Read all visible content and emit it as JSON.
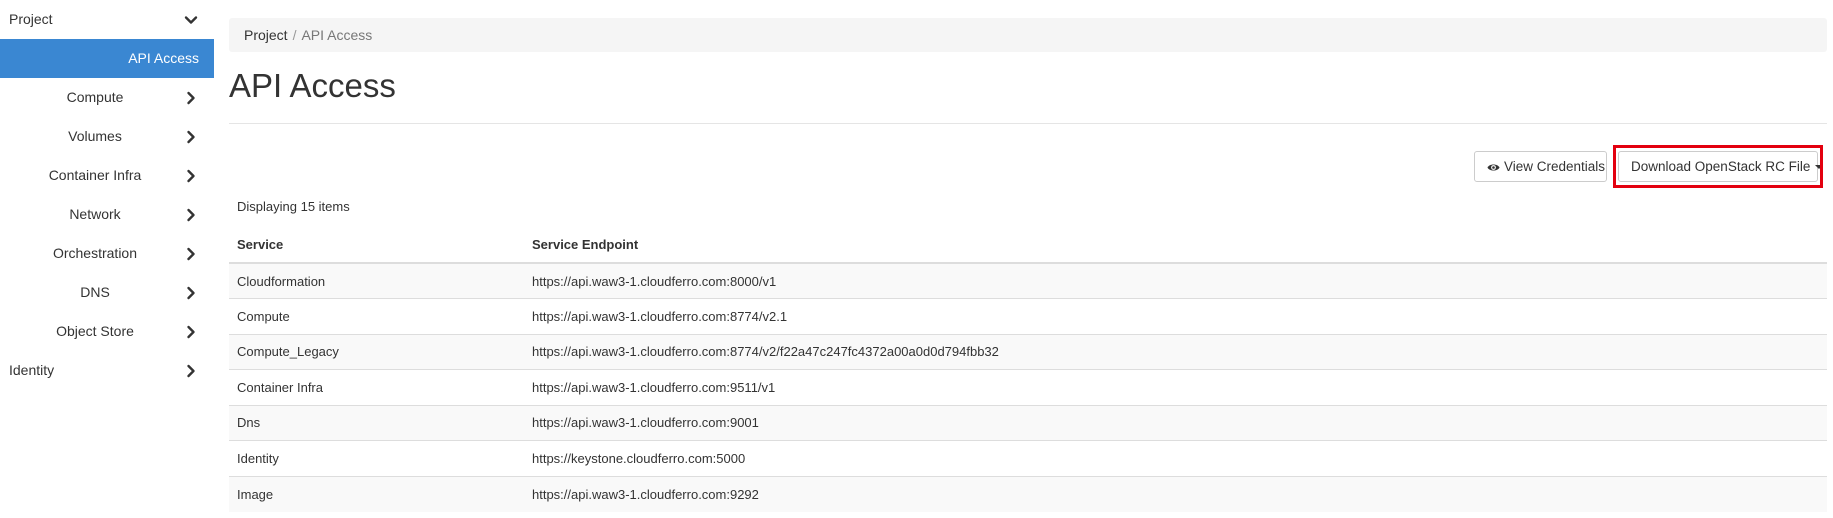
{
  "sidebar": {
    "project": "Project",
    "active_item": "API Access",
    "items": [
      {
        "label": "Compute"
      },
      {
        "label": "Volumes"
      },
      {
        "label": "Container Infra"
      },
      {
        "label": "Network"
      },
      {
        "label": "Orchestration"
      },
      {
        "label": "DNS"
      },
      {
        "label": "Object Store"
      }
    ],
    "identity": "Identity"
  },
  "breadcrumb": {
    "root": "Project",
    "separator": "/",
    "current": "API Access"
  },
  "page": {
    "title": "API Access"
  },
  "actions": {
    "view_credentials": "View Credentials",
    "download_rc": "Download OpenStack RC File"
  },
  "table": {
    "count_text": "Displaying 15 items",
    "headers": {
      "service": "Service",
      "endpoint": "Service Endpoint"
    },
    "rows": [
      {
        "service": "Cloudformation",
        "endpoint": "https://api.waw3-1.cloudferro.com:8000/v1"
      },
      {
        "service": "Compute",
        "endpoint": "https://api.waw3-1.cloudferro.com:8774/v2.1"
      },
      {
        "service": "Compute_Legacy",
        "endpoint": "https://api.waw3-1.cloudferro.com:8774/v2/f22a47c247fc4372a00a0d0d794fbb32"
      },
      {
        "service": "Container Infra",
        "endpoint": "https://api.waw3-1.cloudferro.com:9511/v1"
      },
      {
        "service": "Dns",
        "endpoint": "https://api.waw3-1.cloudferro.com:9001"
      },
      {
        "service": "Identity",
        "endpoint": "https://keystone.cloudferro.com:5000"
      },
      {
        "service": "Image",
        "endpoint": "https://api.waw3-1.cloudferro.com:9292"
      }
    ]
  },
  "colors": {
    "active_nav": "#3a87d2",
    "highlight": "#e3000f"
  }
}
